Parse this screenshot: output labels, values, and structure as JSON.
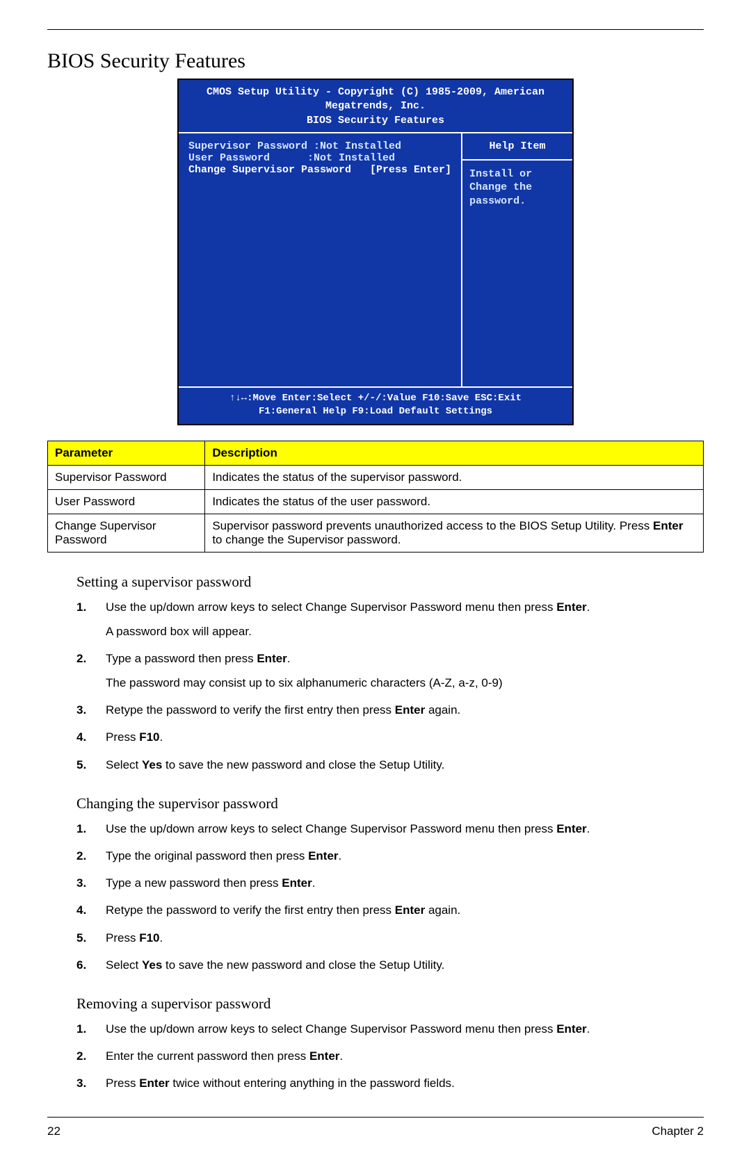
{
  "title": "BIOS Security Features",
  "bios": {
    "header_line1": "CMOS Setup Utility - Copyright (C) 1985-2009, American Megatrends, Inc.",
    "header_line2": "BIOS Security Features",
    "left_lines": {
      "sup_label": "Supervisor Password :Not Installed",
      "user_label": "User Password      :Not Installed",
      "change_label": "Change Supervisor Password   [Press Enter]"
    },
    "help_title": "Help Item",
    "help_body": "Install or Change the password.",
    "footer_line1": "↑↓↔:Move  Enter:Select  +/-/:Value  F10:Save  ESC:Exit",
    "footer_line2": "F1:General Help          F9:Load Default Settings"
  },
  "param_table": {
    "header_param": "Parameter",
    "header_desc": "Description",
    "rows": [
      {
        "param": "Supervisor Password",
        "desc_text": "Indicates the status of the supervisor password."
      },
      {
        "param": "User Password",
        "desc_text": "Indicates the status of the user password."
      },
      {
        "param": "Change Supervisor Password",
        "desc_pre": "Supervisor password prevents unauthorized access to the BIOS Setup Utility. Press ",
        "desc_bold": "Enter",
        "desc_post": " to change the Supervisor password."
      }
    ]
  },
  "setting": {
    "heading": "Setting a supervisor password",
    "steps": [
      {
        "num": "1.",
        "pre": "Use the up/down arrow keys to select Change Supervisor Password menu then press ",
        "bold": "Enter",
        "post": ".",
        "sub": "A password box will appear."
      },
      {
        "num": "2.",
        "pre": "Type a password then press ",
        "bold": "Enter",
        "post": ".",
        "sub": "The password may consist up to six alphanumeric characters (A-Z, a-z, 0-9)"
      },
      {
        "num": "3.",
        "pre": "Retype the password to verify the first entry then press ",
        "bold": "Enter",
        "post": " again."
      },
      {
        "num": "4.",
        "pre": "Press ",
        "bold": "F10",
        "post": "."
      },
      {
        "num": "5.",
        "pre": "Select ",
        "bold": "Yes",
        "post": " to save the new password and close the Setup Utility."
      }
    ]
  },
  "changing": {
    "heading": "Changing the supervisor password",
    "steps": [
      {
        "num": "1.",
        "pre": "Use the up/down arrow keys to select Change Supervisor Password menu then press ",
        "bold": "Enter",
        "post": "."
      },
      {
        "num": "2.",
        "pre": "Type the original password then press ",
        "bold": "Enter",
        "post": "."
      },
      {
        "num": "3.",
        "pre": "Type a new password then press ",
        "bold": "Enter",
        "post": "."
      },
      {
        "num": "4.",
        "pre": "Retype the password to verify the first entry then press ",
        "bold": "Enter",
        "post": " again."
      },
      {
        "num": "5.",
        "pre": "Press ",
        "bold": "F10",
        "post": "."
      },
      {
        "num": "6.",
        "pre": "Select ",
        "bold": "Yes",
        "post": " to save the new password and close the Setup Utility."
      }
    ]
  },
  "removing": {
    "heading": "Removing a supervisor password",
    "steps": [
      {
        "num": "1.",
        "pre": "Use the up/down arrow keys to select Change Supervisor Password menu then press ",
        "bold": "Enter",
        "post": "."
      },
      {
        "num": "2.",
        "pre": "Enter the current password then press ",
        "bold": "Enter",
        "post": "."
      },
      {
        "num": "3.",
        "pre": "Press ",
        "bold": "Enter",
        "post": " twice without entering anything in the password fields."
      }
    ]
  },
  "footer": {
    "page_num": "22",
    "chapter": "Chapter 2"
  }
}
